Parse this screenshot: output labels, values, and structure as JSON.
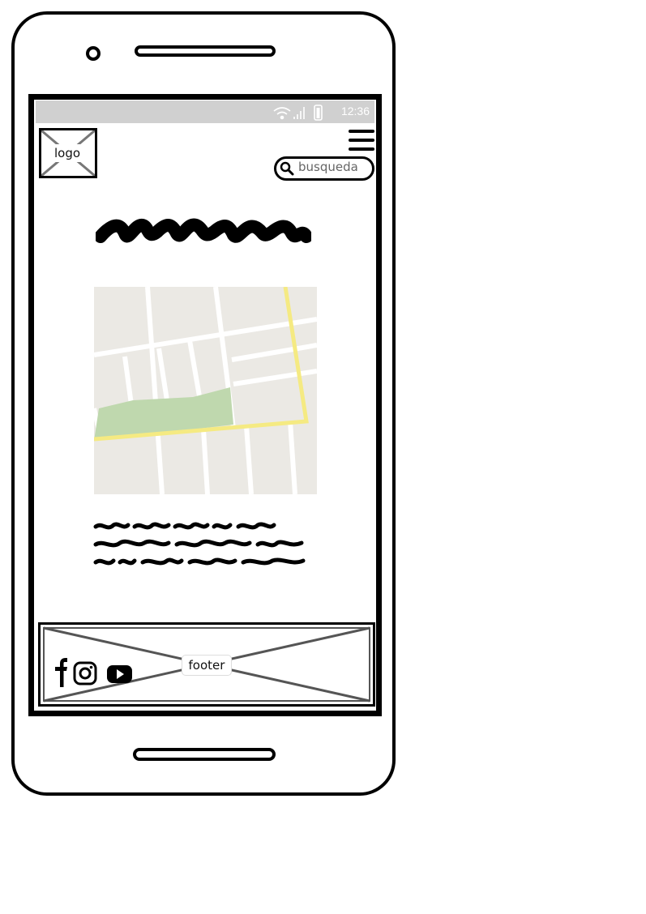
{
  "status_bar": {
    "time": "12:36",
    "icons": [
      "wifi-icon",
      "signal-icon",
      "battery-icon"
    ]
  },
  "header": {
    "logo_label": "logo",
    "search_placeholder": "busqueda",
    "menu_icon": "hamburger-menu-icon"
  },
  "footer": {
    "label": "footer",
    "social_icons": [
      "facebook-icon",
      "instagram-icon",
      "youtube-icon"
    ]
  },
  "colors": {
    "status_bar_bg": "#d0d0d0",
    "map_bg": "#ebe9e4",
    "map_road": "#ffffff",
    "map_highway": "#f5ea82",
    "map_park": "#bfd8ae"
  }
}
